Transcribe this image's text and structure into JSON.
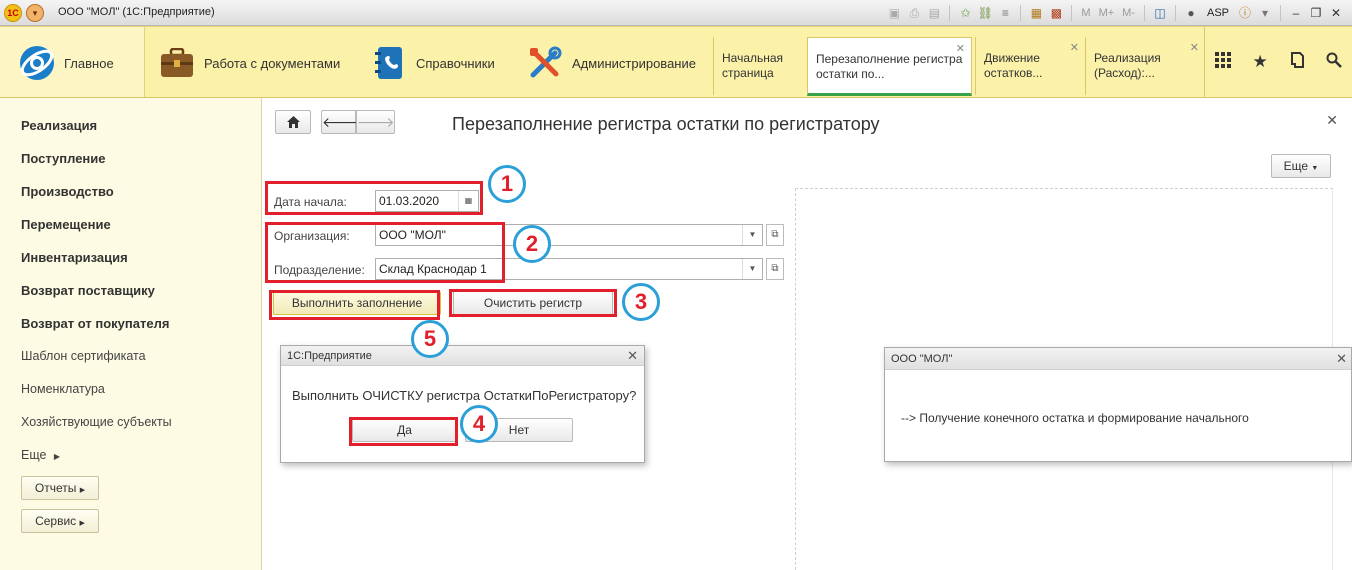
{
  "window": {
    "title": "ООО \"МОЛ\" (1С:Предприятие)",
    "logo_text": "1С",
    "user": "ASP",
    "memory_buttons": [
      "M",
      "M+",
      "M-"
    ]
  },
  "nav": {
    "sections": [
      {
        "label": "Главное",
        "icon": "globe-logo-icon"
      },
      {
        "label": "Работа с документами",
        "icon": "briefcase-icon"
      },
      {
        "label": "Справочники",
        "icon": "phonebook-icon"
      },
      {
        "label": "Администрирование",
        "icon": "tools-icon"
      }
    ],
    "open_tabs": [
      {
        "label": "Начальная страница",
        "closable": false,
        "active": false
      },
      {
        "label": "Перезаполнение регистра остатки по...",
        "closable": true,
        "active": true
      },
      {
        "label": "Движение остатков...",
        "closable": true,
        "active": false
      },
      {
        "label": "Реализация (Расход):...",
        "closable": true,
        "active": false
      }
    ],
    "tools": [
      "grid-icon",
      "star-icon",
      "history-icon",
      "search-icon"
    ]
  },
  "left_panel": {
    "bold_items": [
      "Реализация",
      "Поступление",
      "Производство",
      "Перемещение",
      "Инвентаризация",
      "Возврат поставщику",
      "Возврат от покупателя"
    ],
    "plain_items": [
      "Шаблон сертификата",
      "Номенклатура",
      "Хозяйствующие субъекты",
      "Еще"
    ],
    "buttons": [
      "Отчеты",
      "Сервис"
    ]
  },
  "form": {
    "title": "Перезаполнение регистра остатки по регистратору",
    "more_button": "Еще",
    "date_label": "Дата начала:",
    "date_value": "01.03.2020",
    "org_label": "Организация:",
    "org_value": "ООО \"МОЛ\"",
    "dept_label": "Подразделение:",
    "dept_value": "Склад Краснодар 1",
    "fill_button": "Выполнить заполнение",
    "clear_button": "Очистить регистр"
  },
  "confirm_dialog": {
    "title": "1С:Предприятие",
    "message": "Выполнить ОЧИСТКУ регистра ОстаткиПоРегистратору?",
    "yes": "Да",
    "no": "Нет"
  },
  "message_window": {
    "title": "ООО \"МОЛ\"",
    "message": "--> Получение конечного остатка и формирование начального"
  },
  "annotations": [
    "1",
    "2",
    "3",
    "4",
    "5"
  ],
  "colors": {
    "annotation_red": "#e2202b",
    "annotation_blue": "#2a9fd8",
    "nav_yellow": "#fbf1a8",
    "active_tab_underline": "#3aa34a"
  }
}
